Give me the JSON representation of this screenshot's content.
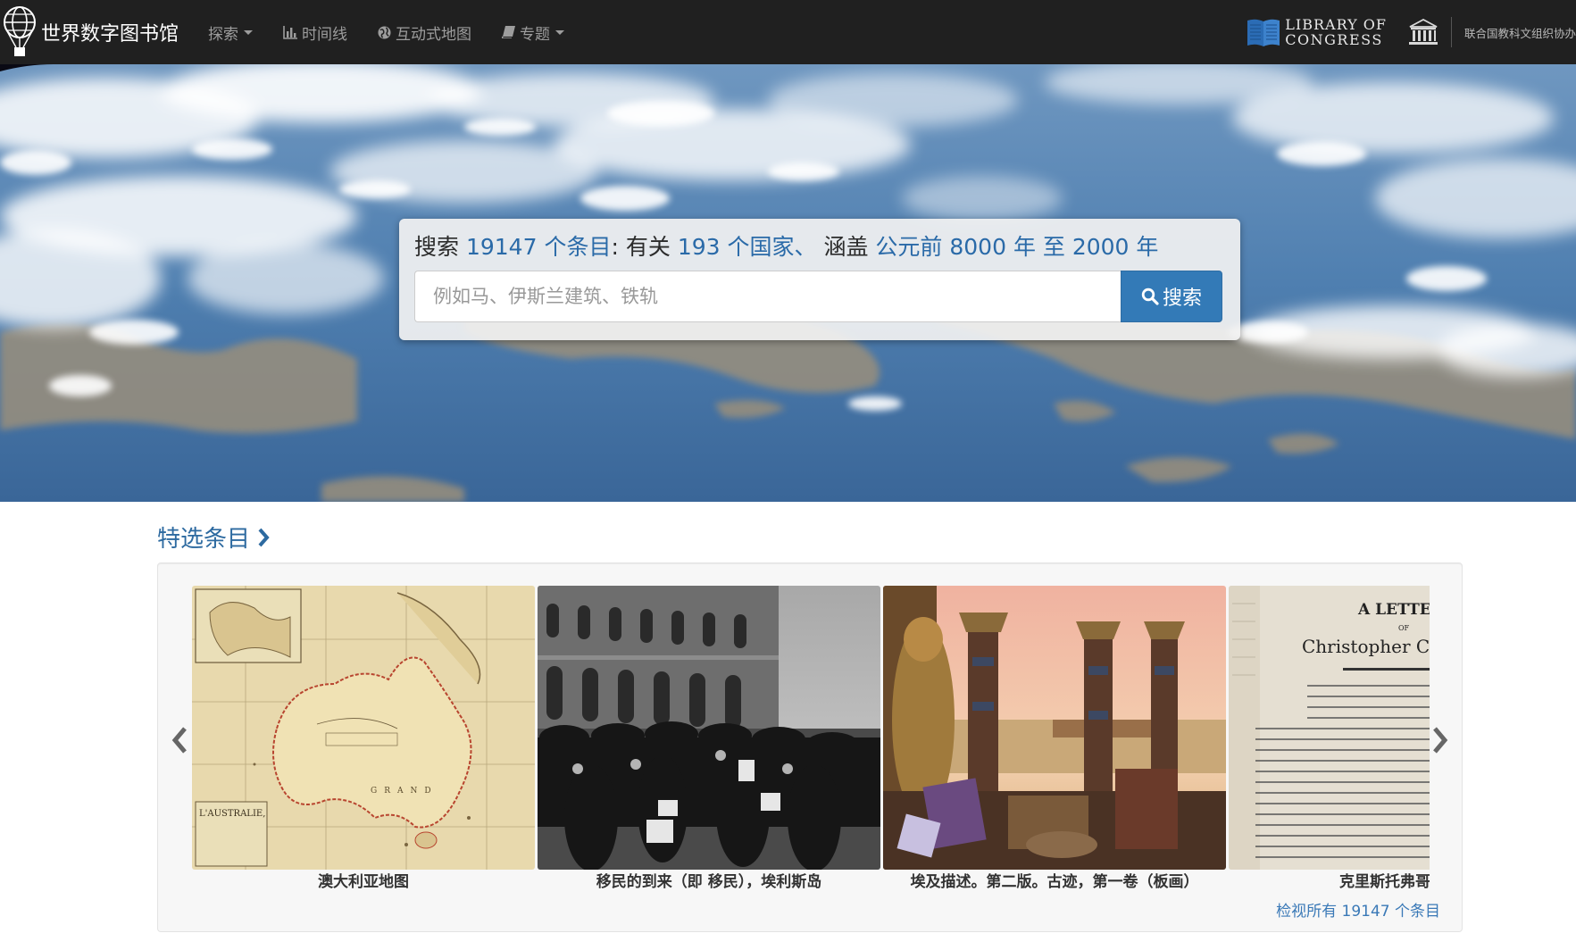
{
  "navbar": {
    "brand": "世界数字图书馆",
    "items": [
      {
        "label": "探索",
        "icon": "",
        "dropdown": true
      },
      {
        "label": "时间线",
        "icon": "bar-chart-icon",
        "dropdown": false
      },
      {
        "label": "互动式地图",
        "icon": "globe-icon",
        "dropdown": false
      },
      {
        "label": "专题",
        "icon": "book-icon",
        "dropdown": true
      }
    ],
    "loc_line1": "LIBRARY OF",
    "loc_line2": "CONGRESS",
    "unesco_text": "联合国教科文组织协办"
  },
  "hero": {
    "stats": {
      "prefix": "搜索",
      "count": "19147 个条目",
      "colon": ":",
      "about": "有关",
      "countries": "193 个国家",
      "comma": "、",
      "covering": "涵盖",
      "range": "公元前 8000 年 至 2000 年"
    },
    "search_placeholder": "例如马、伊斯兰建筑、铁轨",
    "search_button": "搜索"
  },
  "featured": {
    "title": "特选条目",
    "items": [
      {
        "caption": "澳大利亚地图"
      },
      {
        "caption": "移民的到来（即 移民），埃利斯岛"
      },
      {
        "caption": "埃及描述。第二版。古迹，第一卷（板画）"
      },
      {
        "caption": "克里斯托弗哥伦布"
      }
    ],
    "view_all": "检视所有 19147 个条目"
  },
  "thumb_texts": {
    "map_label": "L'AUSTRALIE,",
    "map_ocean": "GRAND",
    "letter_a": "A LETTER",
    "letter_of": "OF",
    "letter_name": "Christopher Columbus"
  },
  "colors": {
    "navbar_bg": "#202020",
    "accent_blue": "#337ab7",
    "link_blue": "#2d6aa0"
  }
}
